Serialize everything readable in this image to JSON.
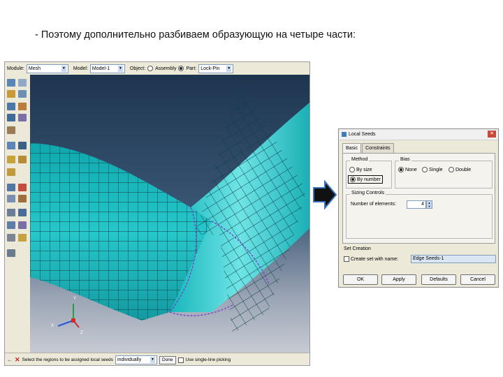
{
  "slide_title": "- Поэтому дополнительно разбиваем образующую на четыре части:",
  "abaqus": {
    "context": {
      "module_label": "Module:",
      "module_value": "Mesh",
      "model_label": "Model:",
      "model_value": "Model-1",
      "object_label": "Object:",
      "assembly_label": "Assembly",
      "part_label": "Part:",
      "part_value": "Lock-Pin"
    },
    "triad": {
      "y": "Y",
      "x": "X",
      "z": "Z"
    },
    "prompt": {
      "text": "Select the regions to be assigned local seeds",
      "select_value": "individually",
      "done_label": "Done",
      "single_pick_label": "Use single-line picking"
    },
    "colors": {
      "mesh": "#19c0c4",
      "mesh_line": "#0b3e45",
      "seed": "#7a3cc8"
    }
  },
  "dialog": {
    "title": "Local Seeds",
    "tabs": [
      "Basic",
      "Constraints"
    ],
    "method": {
      "label": "Method",
      "by_size": "By size",
      "by_number": "By number"
    },
    "bias": {
      "label": "Bias",
      "none": "None",
      "single": "Single",
      "double": "Double"
    },
    "sizing": {
      "label": "Sizing Controls",
      "elements_label": "Number of elements:",
      "elements_value": "4"
    },
    "set_creation": {
      "label": "Set Creation",
      "checkbox_label": "Create set with name:",
      "set_name": "Edge Seeds-1"
    },
    "buttons": {
      "ok": "OK",
      "apply": "Apply",
      "defaults": "Defaults",
      "cancel": "Cancel"
    }
  }
}
